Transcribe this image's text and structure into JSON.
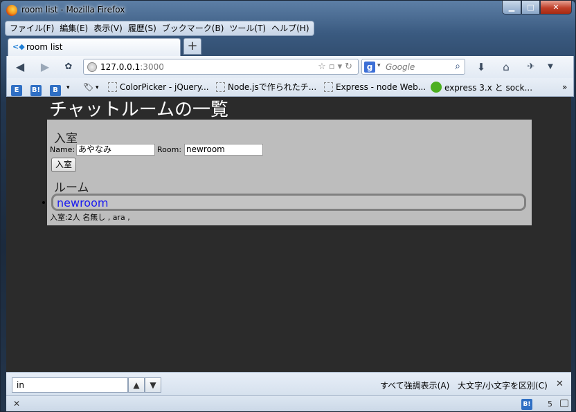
{
  "window": {
    "title": "room list - Mozilla Firefox",
    "min_label": "▁",
    "max_label": "□",
    "close_label": "✕"
  },
  "menubar": {
    "items": [
      "ファイル(F)",
      "編集(E)",
      "表示(V)",
      "履歴(S)",
      "ブックマーク(B)",
      "ツール(T)",
      "ヘルプ(H)"
    ]
  },
  "tabs": {
    "active_title": "room list",
    "new_tab_label": "+"
  },
  "nav": {
    "back_icon": "back-arrow",
    "forward_icon": "forward-arrow",
    "url_host": "127.0.0.1",
    "url_port": ":3000",
    "search_engine": "g",
    "search_placeholder": "Google"
  },
  "bookmarks": {
    "items": [
      {
        "label": "ColorPicker - jQuery...",
        "icon": "empty-page"
      },
      {
        "label": "Node.jsで作られたチ...",
        "icon": "empty-page"
      },
      {
        "label": "Express - node Web...",
        "icon": "empty-page"
      },
      {
        "label": "express 3.x と sock...",
        "icon": "green-circle"
      }
    ],
    "overflow_label": "»"
  },
  "page": {
    "heading": "チャットルームの一覧",
    "enter_section_title": "入室",
    "name_label": "Name:",
    "name_value": "あやなみ",
    "room_label": "Room:",
    "room_value": "newroom",
    "enter_button": "入室",
    "rooms_section_title": "ルーム",
    "rooms": [
      {
        "name": "newroom",
        "info": "入室:2人 名無し , ara ,"
      }
    ]
  },
  "findbar": {
    "query": "in",
    "up_label": "▲",
    "down_label": "▼",
    "highlight_all": "すべて強調表示(A)",
    "match_case": "大文字/小文字を区別(C)",
    "close_label": "✕"
  },
  "status": {
    "close_label": "✕",
    "hatena_label": "B!",
    "count": "5"
  }
}
